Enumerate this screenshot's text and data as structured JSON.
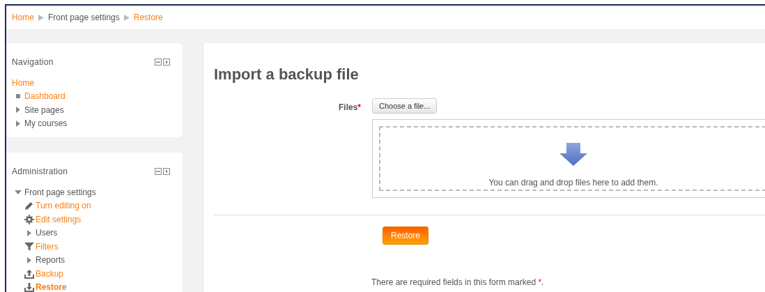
{
  "breadcrumb": [
    {
      "label": "Home",
      "link": true
    },
    {
      "label": "Front page settings",
      "link": false
    },
    {
      "label": "Restore",
      "link": true
    }
  ],
  "blocks": [
    {
      "title": "Navigation",
      "items": [
        {
          "label": "Home",
          "kind": "plain",
          "link": true,
          "selected": false
        },
        {
          "label": "Dashboard",
          "kind": "bullet",
          "link": true,
          "selected": false
        },
        {
          "label": "Site pages",
          "kind": "collapsed",
          "link": false,
          "selected": false
        },
        {
          "label": "My courses",
          "kind": "collapsed",
          "link": false,
          "selected": false
        }
      ]
    },
    {
      "title": "Administration",
      "items": [
        {
          "label": "Front page settings",
          "kind": "expanded",
          "link": false,
          "selected": false,
          "children": [
            {
              "label": "Turn editing on",
              "kind": "pencil",
              "link": true,
              "selected": false
            },
            {
              "label": "Edit settings",
              "kind": "gear",
              "link": true,
              "selected": false
            },
            {
              "label": "Users",
              "kind": "collapsed",
              "link": false,
              "selected": false
            },
            {
              "label": "Filters",
              "kind": "filter",
              "link": true,
              "selected": false
            },
            {
              "label": "Reports",
              "kind": "collapsed",
              "link": false,
              "selected": false
            },
            {
              "label": "Backup",
              "kind": "upload",
              "link": true,
              "selected": false
            },
            {
              "label": "Restore",
              "kind": "download",
              "link": true,
              "selected": true
            }
          ]
        }
      ]
    }
  ],
  "main": {
    "title": "Import a backup file",
    "files_label": "Files",
    "required_mark": "*",
    "choose_button": "Choose a file...",
    "drop_hint": "You can drag and drop files here to add them.",
    "submit_button": "Restore",
    "required_note": "There are required fields in this form marked",
    "required_note_mark": "*",
    "required_note_end": "."
  }
}
